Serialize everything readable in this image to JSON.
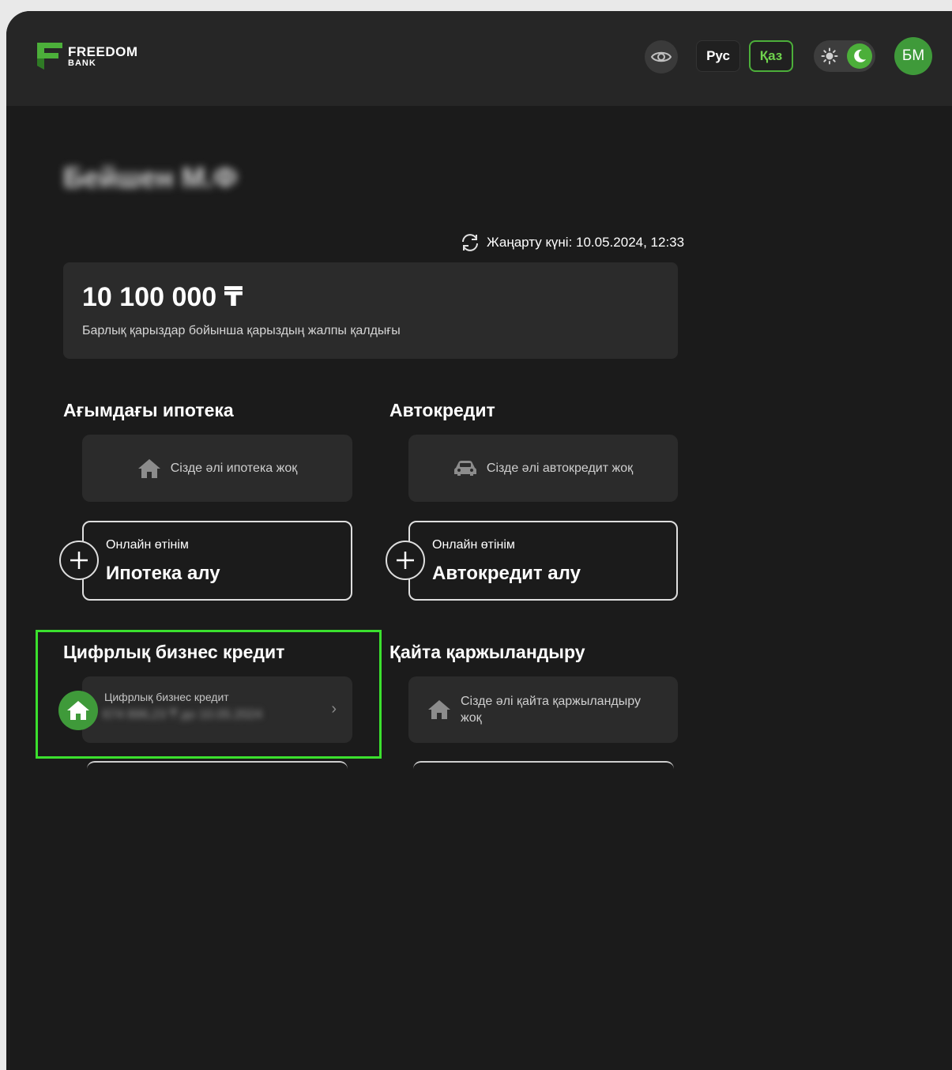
{
  "header": {
    "logo": {
      "main": "FREEDOM",
      "sub": "BANK"
    },
    "lang_ru": "Рус",
    "lang_kz": "Қаз",
    "avatar_initials": "БМ",
    "icons": {
      "visibility": "eye-icon",
      "light": "sun-icon",
      "dark": "moon-icon"
    },
    "colors": {
      "accent": "#4caf3a",
      "avatar": "#3f9a3a"
    }
  },
  "user": {
    "name": "Бейшен М.Ф"
  },
  "updated": {
    "label": "Жаңарту күні: 10.05.2024, 12:33"
  },
  "summary": {
    "amount": "10 100 000 ₸",
    "label": "Барлық қарыздар бойынша қарыздың жалпы қалдығы"
  },
  "mortgage": {
    "title": "Ағымдағы ипотека",
    "empty": "Сізде әлі ипотека жоқ",
    "apply_small": "Онлайн өтінім",
    "apply_big": "Ипотека алу"
  },
  "autoloan": {
    "title": "Автокредит",
    "empty": "Сізде әлі автокредит жоқ",
    "apply_small": "Онлайн өтінім",
    "apply_big": "Автокредит алу"
  },
  "business": {
    "title": "Цифрлық бизнес кредит",
    "item_label": "Цифрлық бизнес кредит",
    "item_value": "674 896,23 ₸ до 10.05.2024",
    "highlight_color": "#3be02e"
  },
  "refinance": {
    "title": "Қайта қаржыландыру",
    "empty": "Сізде әлі қайта қаржыландыру жоқ"
  }
}
